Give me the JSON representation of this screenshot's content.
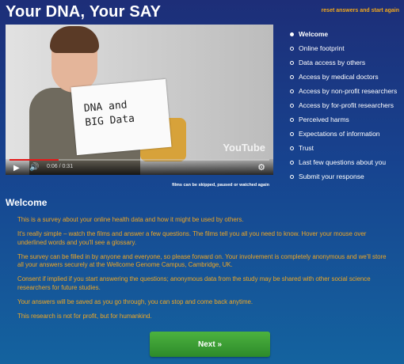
{
  "header": {
    "title": "Your DNA, Your SAY",
    "reset_link": "reset answers and start again"
  },
  "video": {
    "sign_text": "DNA and\nBIG Data",
    "brand": "YouTube",
    "time": "0:06 / 0:31",
    "progress_fraction": 0.19,
    "note": "films can be skipped, paused or watched again"
  },
  "nav": [
    {
      "label": "Welcome",
      "active": true
    },
    {
      "label": "Online footprint"
    },
    {
      "label": "Data access by others"
    },
    {
      "label": "Access by medical doctors"
    },
    {
      "label": "Access by non-profit researchers"
    },
    {
      "label": "Access by for-profit researchers"
    },
    {
      "label": "Perceived harms"
    },
    {
      "label": "Expectations of information"
    },
    {
      "label": "Trust"
    },
    {
      "label": "Last few questions about you"
    },
    {
      "label": "Submit your response"
    }
  ],
  "section": {
    "title": "Welcome"
  },
  "paragraphs": [
    "This is a survey about your online health data and how it might be used by others.",
    "It's really simple – watch the films and answer a few questions. The films tell you all you need to know. Hover your mouse over underlined words and you'll see a glossary.",
    "The survey can be filled in by anyone and everyone, so please forward on. Your involvement is completely anonymous and we'll store all your answers securely at the Wellcome Genome Campus, Cambridge, UK.",
    "Consent if implied if you start answering the questions; anonymous data from the study may be shared with other social science researchers for future studies.",
    "Your answers will be saved as you go through, you can stop and come back anytime.",
    "This research is not for profit, but for humankind."
  ],
  "next_button": {
    "label": "Next  »"
  },
  "colors": {
    "accent_orange": "#f0a723",
    "button_green": "#3c9f36"
  }
}
